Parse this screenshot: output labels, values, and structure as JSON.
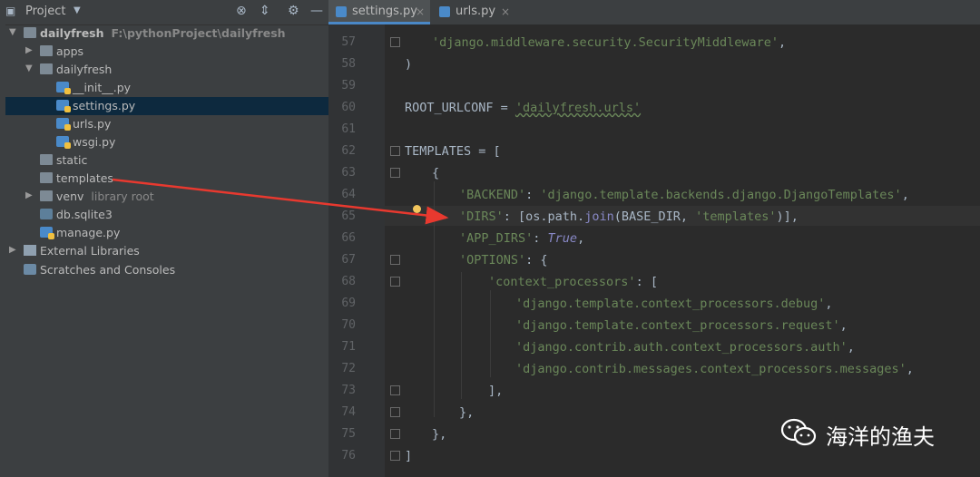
{
  "project_panel": {
    "title": "Project",
    "tree": [
      {
        "label": "dailyfresh",
        "sub": "F:\\pythonProject\\dailyfresh"
      },
      {
        "label": "apps"
      },
      {
        "label": "dailyfresh"
      },
      {
        "label": "__init__.py"
      },
      {
        "label": "settings.py"
      },
      {
        "label": "urls.py"
      },
      {
        "label": "wsgi.py"
      },
      {
        "label": "static"
      },
      {
        "label": "templates"
      },
      {
        "label": "venv",
        "sub": "library root"
      },
      {
        "label": "db.sqlite3"
      },
      {
        "label": "manage.py"
      },
      {
        "label": "External Libraries"
      },
      {
        "label": "Scratches and Consoles"
      }
    ]
  },
  "tabs": [
    {
      "label": "settings.py",
      "active": true
    },
    {
      "label": "urls.py",
      "active": false
    }
  ],
  "editor": {
    "line_numbers": [
      "57",
      "58",
      "59",
      "60",
      "61",
      "62",
      "63",
      "64",
      "65",
      "66",
      "67",
      "68",
      "69",
      "70",
      "71",
      "72",
      "73",
      "74",
      "75",
      "76"
    ],
    "current_line": "65",
    "strings": {
      "l57": "'django.middleware.security.SecurityMiddleware'",
      "l57b": ",",
      "l58": ")",
      "l60a": "ROOT_URLCONF = ",
      "l60b": "'dailyfresh.urls'",
      "l62a": "TEMPLATES = [",
      "l63": "{",
      "l64a": "'BACKEND'",
      "l64b": ": ",
      "l64c": "'django.template.backends.django.DjangoTemplates'",
      "l64d": ",",
      "l65a": "'DIRS'",
      "l65b": ": [os.path.",
      "l65c": "join",
      "l65d": "(BASE_DIR, ",
      "l65e": "'templates'",
      "l65f": ")],",
      "l66a": "'APP_DIRS'",
      "l66b": ": ",
      "l66c": "True",
      "l66d": ",",
      "l67a": "'OPTIONS'",
      "l67b": ": {",
      "l68a": "'context_processors'",
      "l68b": ": [",
      "l69a": "'django.template.context_processors.debug'",
      "l69b": ",",
      "l70a": "'django.template.context_processors.request'",
      "l70b": ",",
      "l71a": "'django.contrib.auth.context_processors.auth'",
      "l71b": ",",
      "l72a": "'django.contrib.messages.context_processors.messages'",
      "l72b": ",",
      "l73": "],",
      "l74": "},",
      "l75": "},",
      "l76": "]"
    }
  },
  "watermark": {
    "text": "海洋的渔夫"
  },
  "colors": {
    "accent": "#4a88c7",
    "arrow": "#e8392f",
    "string": "#6a8759",
    "keyword": "#cc7832"
  }
}
